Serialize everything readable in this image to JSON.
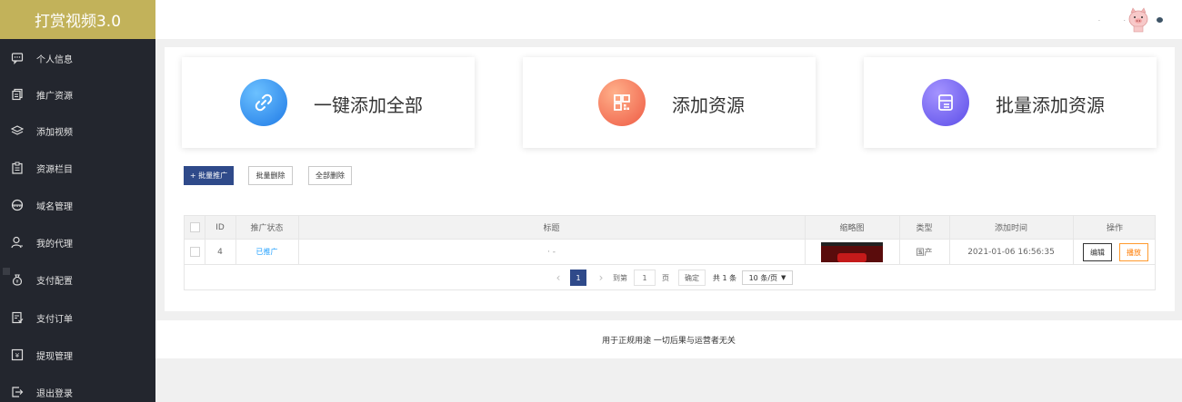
{
  "app": {
    "title": "打赏视频3.0"
  },
  "sidebar": {
    "items": [
      {
        "label": "个人信息",
        "icon": "chat-icon"
      },
      {
        "label": "推广资源",
        "icon": "copy-icon"
      },
      {
        "label": "添加视频",
        "icon": "layers-icon"
      },
      {
        "label": "资源栏目",
        "icon": "clipboard-icon"
      },
      {
        "label": "域名管理",
        "icon": "globe-icon"
      },
      {
        "label": "我的代理",
        "icon": "user-icon"
      },
      {
        "label": "支付配置",
        "icon": "money-bag-icon"
      },
      {
        "label": "支付订单",
        "icon": "order-icon"
      },
      {
        "label": "提现管理",
        "icon": "withdraw-icon"
      },
      {
        "label": "退出登录",
        "icon": "logout-icon"
      }
    ]
  },
  "header": {
    "dots": "· ·",
    "avatar_icon": "pig-avatar-icon"
  },
  "cards": [
    {
      "label": "一键添加全部",
      "icon": "link-icon",
      "color": "#2d8cf0"
    },
    {
      "label": "添加资源",
      "icon": "qrcode-icon",
      "color": "#f36a4a"
    },
    {
      "label": "批量添加资源",
      "icon": "list-panel-icon",
      "color": "#6a5cf2"
    }
  ],
  "toolbar": {
    "batch_promote": "+ 批量推广",
    "batch_delete": "批量删除",
    "delete_all": "全部删除"
  },
  "table": {
    "headers": {
      "id": "ID",
      "status": "推广状态",
      "title": "标题",
      "thumb": "缩略图",
      "type": "类型",
      "time": "添加时间",
      "ops": "操作"
    },
    "rows": [
      {
        "id": "4",
        "status": "已推广",
        "title": "· -",
        "type": "国产",
        "time": "2021-01-06 16:56:35",
        "edit": "编辑",
        "play": "播放"
      }
    ]
  },
  "pagination": {
    "prev": "‹",
    "current": "1",
    "next": "›",
    "goto_label": "到第",
    "goto_value": "1",
    "page_unit": "页",
    "confirm": "确定",
    "total": "共 1 条",
    "page_size": "10 条/页"
  },
  "footer": {
    "text": "用于正规用途 一切后果与运营者无关"
  }
}
